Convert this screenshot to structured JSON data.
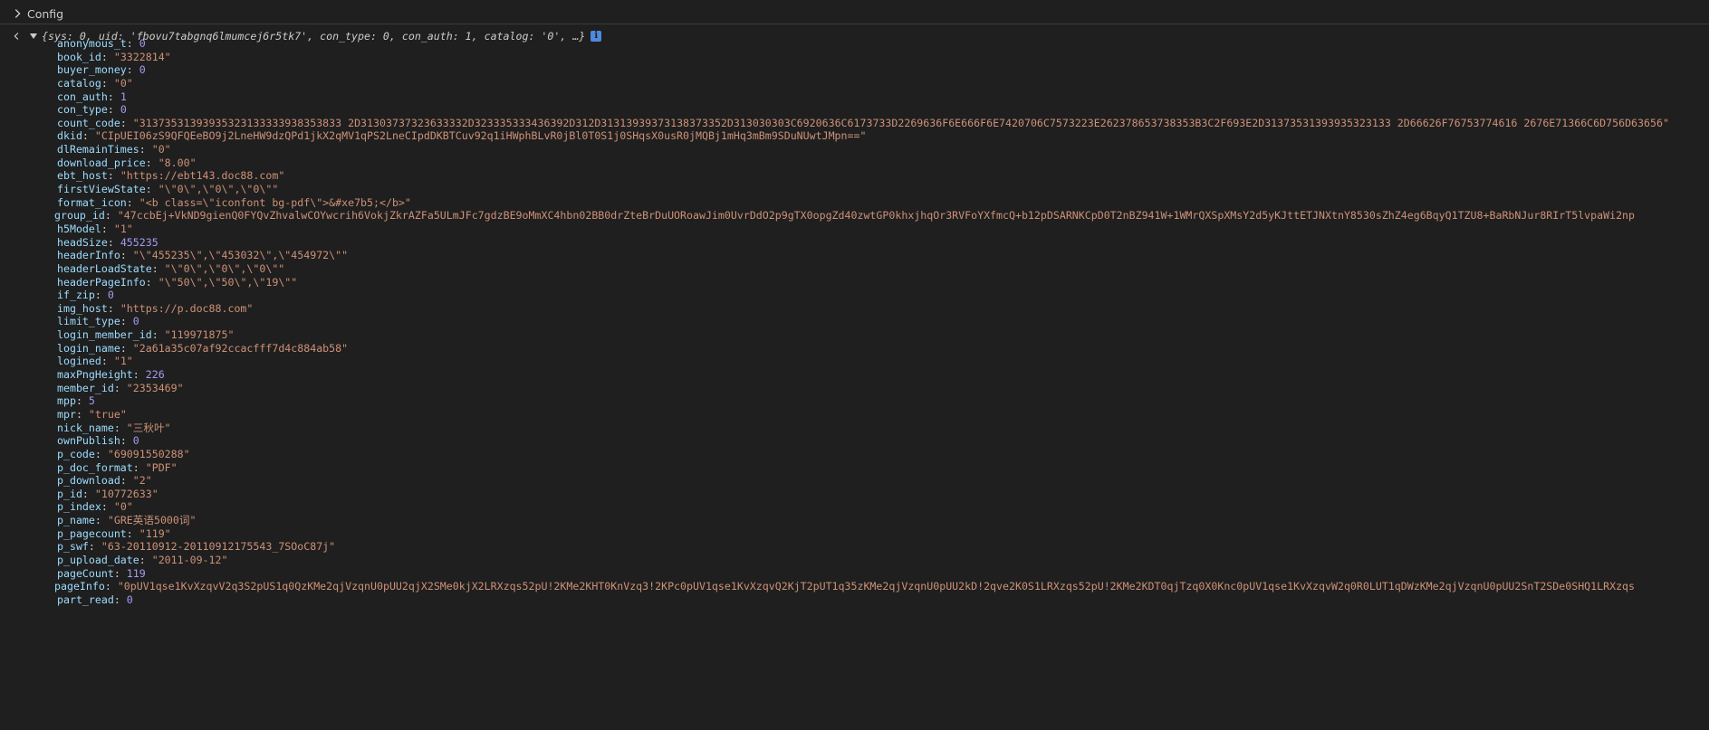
{
  "header": {
    "title": "Config"
  },
  "object_summary": "{sys: 0, uid: 'fbovu7tabgnq6lmumcej6r5tk7', con_type: 0, con_auth: 1, catalog: '0', …}",
  "info_badge": "i",
  "properties": [
    {
      "key": "anonymous_t",
      "value": "0",
      "type": "number"
    },
    {
      "key": "book_id",
      "value": "\"3322814\"",
      "type": "string"
    },
    {
      "key": "buyer_money",
      "value": "0",
      "type": "number"
    },
    {
      "key": "catalog",
      "value": "\"0\"",
      "type": "string"
    },
    {
      "key": "con_auth",
      "value": "1",
      "type": "number"
    },
    {
      "key": "con_type",
      "value": "0",
      "type": "number"
    },
    {
      "key": "count_code",
      "value": "\"31373531393935323133333938353833 2D31303737323633332D323335333436392D312D31313939373138373352D313030303C6920636C6173733D2269636F6E666F6E7420706C7573223E262378653738353B3C2F693E2D31373531393935323133 2D66626F76753774616 2676E71366C6D756D63656\"",
      "type": "string"
    },
    {
      "key": "dkid",
      "value": "\"CIpUEI06zS9QFQEeBO9j2LneHW9dzQPd1jkX2qMV1qPS2LneCIpdDKBTCuv92q1iHWphBLvR0jBl0T0S1j0SHqsX0usR0jMQBj1mHq3mBm9SDuNUwtJMpn==\"",
      "type": "string"
    },
    {
      "key": "dlRemainTimes",
      "value": "\"0\"",
      "type": "string"
    },
    {
      "key": "download_price",
      "value": "\"8.00\"",
      "type": "string"
    },
    {
      "key": "ebt_host",
      "value": "\"https://ebt143.doc88.com\"",
      "type": "string"
    },
    {
      "key": "firstViewState",
      "value": "\"\\\"0\\\",\\\"0\\\",\\\"0\\\"\"",
      "type": "string"
    },
    {
      "key": "format_icon",
      "value": "\"<b class=\\\"iconfont bg-pdf\\\">&#xe7b5;</b>\"",
      "type": "string"
    },
    {
      "key": "group_id",
      "value": "\"47ccbEj+VkND9gienQ0FYQvZhvalwCOYwcrih6VokjZkrAZFa5ULmJFc7gdzBE9oMmXC4hbn02BB0drZteBrDuUORoawJim0UvrDdO2p9gTX0opgZd40zwtGP0khxjhqOr3RVFoYXfmcQ+b12pDSARNKCpD0T2nBZ941W+1WMrQXSpXMsY2d5yKJttETJNXtnY8530sZhZ4eg6BqyQ1TZU8+BaRbNJur8RIrT5lvpaWi2np",
      "type": "string",
      "shift": true
    },
    {
      "key": "h5Model",
      "value": "\"1\"",
      "type": "string"
    },
    {
      "key": "headSize",
      "value": "455235",
      "type": "number"
    },
    {
      "key": "headerInfo",
      "value": "\"\\\"455235\\\",\\\"453032\\\",\\\"454972\\\"\"",
      "type": "string"
    },
    {
      "key": "headerLoadState",
      "value": "\"\\\"0\\\",\\\"0\\\",\\\"0\\\"\"",
      "type": "string"
    },
    {
      "key": "headerPageInfo",
      "value": "\"\\\"50\\\",\\\"50\\\",\\\"19\\\"\"",
      "type": "string"
    },
    {
      "key": "if_zip",
      "value": "0",
      "type": "number"
    },
    {
      "key": "img_host",
      "value": "\"https://p.doc88.com\"",
      "type": "string"
    },
    {
      "key": "limit_type",
      "value": "0",
      "type": "number"
    },
    {
      "key": "login_member_id",
      "value": "\"119971875\"",
      "type": "string"
    },
    {
      "key": "login_name",
      "value": "\"2a61a35c07af92ccacfff7d4c884ab58\"",
      "type": "string"
    },
    {
      "key": "logined",
      "value": "\"1\"",
      "type": "string"
    },
    {
      "key": "maxPngHeight",
      "value": "226",
      "type": "number"
    },
    {
      "key": "member_id",
      "value": "\"2353469\"",
      "type": "string"
    },
    {
      "key": "mpp",
      "value": "5",
      "type": "number"
    },
    {
      "key": "mpr",
      "value": "\"true\"",
      "type": "string"
    },
    {
      "key": "nick_name",
      "value": "\"三秋叶\"",
      "type": "string"
    },
    {
      "key": "ownPublish",
      "value": "0",
      "type": "number"
    },
    {
      "key": "p_code",
      "value": "\"69091550288\"",
      "type": "string"
    },
    {
      "key": "p_doc_format",
      "value": "\"PDF\"",
      "type": "string"
    },
    {
      "key": "p_download",
      "value": "\"2\"",
      "type": "string"
    },
    {
      "key": "p_id",
      "value": "\"10772633\"",
      "type": "string"
    },
    {
      "key": "p_index",
      "value": "\"0\"",
      "type": "string"
    },
    {
      "key": "p_name",
      "value": "\"GRE英语5000词\"",
      "type": "string"
    },
    {
      "key": "p_pagecount",
      "value": "\"119\"",
      "type": "string"
    },
    {
      "key": "p_swf",
      "value": "\"63-20110912-20110912175543_7SOoC87j\"",
      "type": "string"
    },
    {
      "key": "p_upload_date",
      "value": "\"2011-09-12\"",
      "type": "string"
    },
    {
      "key": "pageCount",
      "value": "119",
      "type": "number"
    },
    {
      "key": "pageInfo",
      "value": "\"0pUV1qse1KvXzqvV2q3S2pUS1q0QzKMe2qjVzqnU0pUU2qjX2SMe0kjX2LRXzqs52pU!2KMe2KHT0KnVzq3!2KPc0pUV1qse1KvXzqvQ2KjT2pUT1q35zKMe2qjVzqnU0pUU2kD!2qve2K0S1LRXzqs52pU!2KMe2KDT0qjTzq0X0Knc0pUV1qse1KvXzqvW2q0R0LUT1qDWzKMe2qjVzqnU0pUU2SnT2SDe0SHQ1LRXzqs",
      "type": "string",
      "shift": true
    },
    {
      "key": "part_read",
      "value": "0",
      "type": "number"
    }
  ],
  "colors": {
    "background": "#1f1f1f",
    "key": "#9cdcfe",
    "string": "#ce9178",
    "number": "#a79af4",
    "text": "#cccccc"
  },
  "icons": {
    "group_toggle": "chevron-right-icon",
    "back": "back-arrow-icon",
    "expand": "triangle-down-icon",
    "info": "info-icon"
  }
}
